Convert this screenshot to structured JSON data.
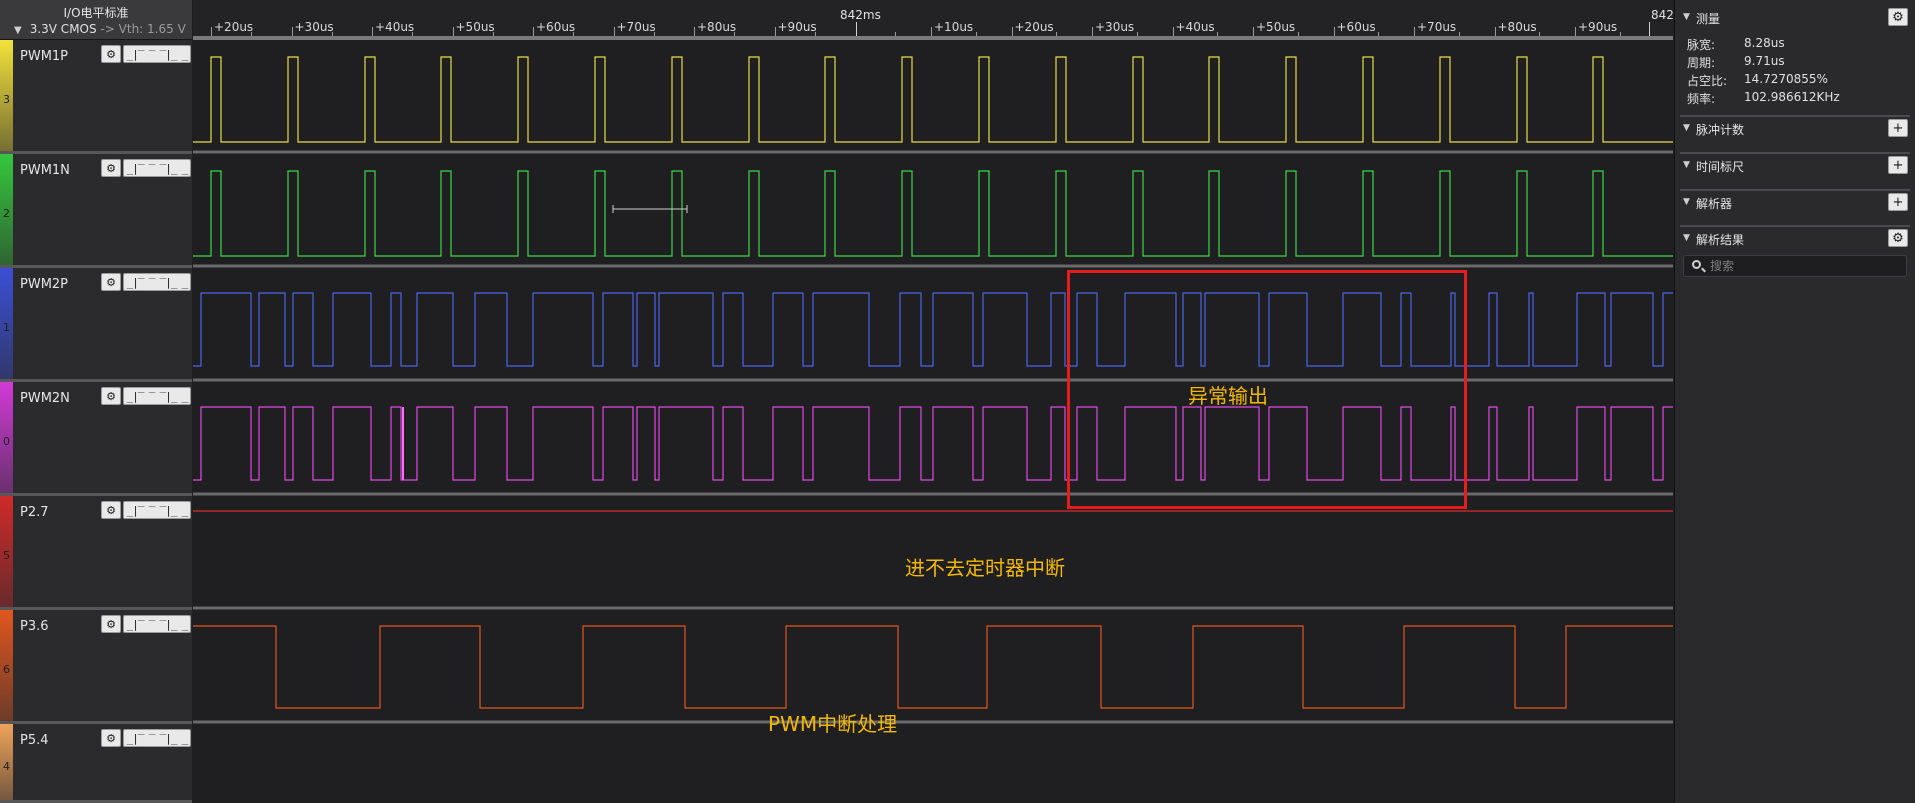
{
  "io_panel": {
    "title": "I/O电平标准",
    "standard": "3.3V CMOS",
    "arrow": "->",
    "vth": "Vth: 1.65 V"
  },
  "channels": [
    {
      "name": "PWM1P",
      "index": "3",
      "strip_color": "#f3e23a",
      "wave_color": "#e7dc4b"
    },
    {
      "name": "PWM1N",
      "index": "2",
      "strip_color": "#35c73d",
      "wave_color": "#3fd64a"
    },
    {
      "name": "PWM2P",
      "index": "1",
      "strip_color": "#3b4fd6",
      "wave_color": "#4b63e6"
    },
    {
      "name": "PWM2N",
      "index": "0",
      "strip_color": "#d23ad8",
      "wave_color": "#e04ae6"
    },
    {
      "name": "P2.7",
      "index": "5",
      "strip_color": "#d02a2a",
      "wave_color": "#d43030"
    },
    {
      "name": "P3.6",
      "index": "6",
      "strip_color": "#e0561f",
      "wave_color": "#e0561f"
    },
    {
      "name": "P5.4",
      "index": "4",
      "strip_color": "#f0a35a",
      "wave_color": "#f0a35a"
    }
  ],
  "ruler": {
    "left_labels": [
      "+20us",
      "+30us",
      "+40us",
      "+50us",
      "+60us",
      "+70us",
      "+80us",
      "+90us"
    ],
    "major_label": "842ms",
    "right_labels": [
      "+10us",
      "+20us",
      "+30us",
      "+40us",
      "+50us",
      "+60us",
      "+70us",
      "+80us",
      "+90us"
    ],
    "edge_label": "842"
  },
  "annotations": {
    "anomaly": "异常输出",
    "no_timer": "进不去定时器中断",
    "pwm_isr": "PWM中断处理"
  },
  "right_panel": {
    "measure": {
      "title": "测量",
      "rows": [
        {
          "label": "脉宽:",
          "value": "8.28us"
        },
        {
          "label": "周期:",
          "value": "9.71us"
        },
        {
          "label": "占空比:",
          "value": "14.7270855%"
        },
        {
          "label": "频率:",
          "value": "102.986612KHz"
        }
      ]
    },
    "pulse_count": {
      "title": "脉冲计数"
    },
    "time_ruler": {
      "title": "时间标尺"
    },
    "analyzer": {
      "title": "解析器"
    },
    "results": {
      "title": "解析结果",
      "search_placeholder": "搜索"
    }
  },
  "colors": {
    "anomaly_box": "#e41e1e",
    "annotation": "#f5b800"
  },
  "icons": {
    "gear": "gear-icon",
    "edge": "edge-trigger-icon",
    "plus": "plus-icon",
    "search": "search-icon",
    "collapse": "triangle-down-icon"
  }
}
